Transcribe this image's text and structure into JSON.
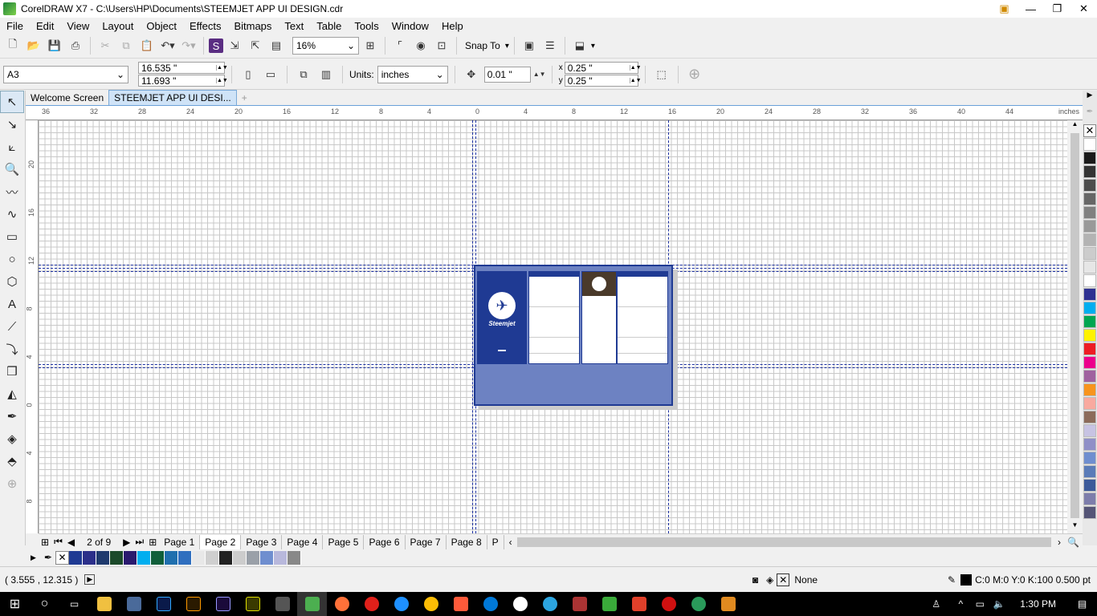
{
  "window": {
    "title": "CorelDRAW X7 - C:\\Users\\HP\\Documents\\STEEMJET APP UI DESIGN.cdr",
    "min": "—",
    "max": "❐",
    "close": "✕"
  },
  "menu": [
    "File",
    "Edit",
    "View",
    "Layout",
    "Object",
    "Effects",
    "Bitmaps",
    "Text",
    "Table",
    "Tools",
    "Window",
    "Help"
  ],
  "toolbar": {
    "zoom": "16%",
    "snap_to": "Snap To"
  },
  "property_bar": {
    "page_size": "A3",
    "width": "16.535 \"",
    "height": "11.693 \"",
    "units_label": "Units:",
    "units": "inches",
    "nudge": "0.01 \"",
    "dup_x": "0.25 \"",
    "dup_y": "0.25 \""
  },
  "doc_tabs": [
    "Welcome Screen",
    "STEEMJET APP UI DESI..."
  ],
  "ruler": {
    "unit": "inches",
    "h_labels": [
      "36",
      "32",
      "28",
      "24",
      "20",
      "16",
      "12",
      "8",
      "4",
      "0",
      "4",
      "8",
      "12",
      "16",
      "20",
      "24",
      "28",
      "32",
      "36",
      "40",
      "44"
    ],
    "v_labels": [
      "20",
      "16",
      "12",
      "8",
      "4",
      "0",
      "4",
      "8"
    ]
  },
  "design": {
    "logo_text": "Steemjet"
  },
  "pages": {
    "counter": "2 of 9",
    "tabs": [
      "Page 1",
      "Page 2",
      "Page 3",
      "Page 4",
      "Page 5",
      "Page 6",
      "Page 7",
      "Page 8",
      "P"
    ]
  },
  "status": {
    "coords": "( 3.555 , 12.315 )",
    "fill": "None",
    "outline": "C:0 M:0 Y:0 K:100  0.500 pt"
  },
  "taskbar": {
    "time": "1:30 PM"
  },
  "colors": {
    "accent": "#1f3a93",
    "palette": [
      "#ffffff",
      "#1a1a1a",
      "#333333",
      "#4d4d4d",
      "#666666",
      "#808080",
      "#999999",
      "#b3b3b3",
      "#cccccc",
      "#e6e6e6",
      "#ffffff",
      "#2e3192",
      "#00aeef",
      "#00a651",
      "#fff200",
      "#ed1c24",
      "#ec008c",
      "#a0619f",
      "#f7941d",
      "#f9a99f",
      "#8c6b5a",
      "#c7c3e3",
      "#8f8fc7",
      "#6f8ecf",
      "#5a7bb8",
      "#3c5a9a",
      "#7d7dab",
      "#555577"
    ],
    "doc_palette": [
      "#1f3a93",
      "#2b2f8a",
      "#1f3a6e",
      "#1c4a2a",
      "#2a1a6e",
      "#00aeef",
      "#0f5f3a",
      "#1f6fae",
      "#2f6fbf",
      "#e8e8e8",
      "#cfcfcf",
      "#222222",
      "#cccccc",
      "#9aa0a8",
      "#6f8ecf",
      "#b8b8dc",
      "#888888"
    ]
  }
}
